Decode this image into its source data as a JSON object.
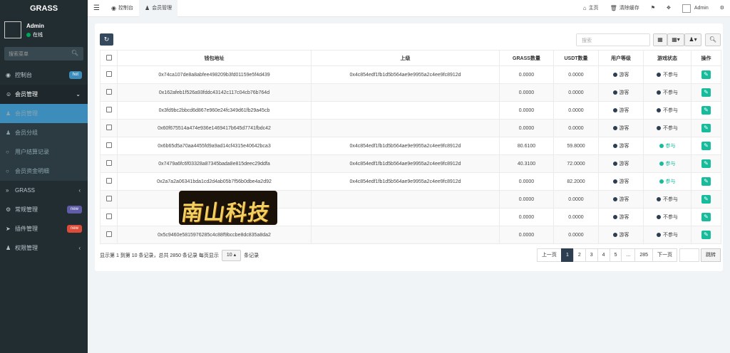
{
  "app": {
    "logo": "GRASS"
  },
  "user": {
    "name": "Admin",
    "status": "在线"
  },
  "sidebar": {
    "search_placeholder": "搜索菜单",
    "items": [
      {
        "label": "控制台",
        "badge": "hot",
        "badge_color": "#3c8dbc"
      },
      {
        "label": "会员管理"
      },
      {
        "label": "会员管理"
      },
      {
        "label": "会员分组"
      },
      {
        "label": "用户结算记录"
      },
      {
        "label": "会员资金明细"
      },
      {
        "label": "GRASS"
      },
      {
        "label": "常规管理",
        "badge": "new",
        "badge_color": "#605ca8"
      },
      {
        "label": "插件管理",
        "badge": "new",
        "badge_color": "#dd4b39"
      },
      {
        "label": "权限管理"
      }
    ]
  },
  "topbar": {
    "tabs": [
      {
        "label": "控制台"
      },
      {
        "label": "会员管理"
      }
    ],
    "home": "主页",
    "clear_cache": "清除缓存",
    "admin": "Admin"
  },
  "toolbar": {
    "search_placeholder": "搜索"
  },
  "table": {
    "headers": [
      "钱包地址",
      "上级",
      "GRASS数量",
      "USDT数量",
      "用户等级",
      "游戏状态",
      "操作"
    ],
    "rows": [
      {
        "wallet": "0x74ca107de8a8abfee498209b3fd01159e5f4d439",
        "parent": "0x4c854edf1fb1d5b564ae9e9955a2c4ee9fc8912d",
        "grass": "0.0000",
        "usdt": "0.0000",
        "level": "游客",
        "status": "不参与"
      },
      {
        "wallet": "0x162afeb1f526a93fddc43142c117c04cb76b764d",
        "parent": "",
        "grass": "0.0000",
        "usdt": "0.0000",
        "level": "游客",
        "status": "不参与"
      },
      {
        "wallet": "0x3fd9bc2bbcd6d867e960e24fc349d61fb29a45cb",
        "parent": "",
        "grass": "0.0000",
        "usdt": "0.0000",
        "level": "游客",
        "status": "不参与"
      },
      {
        "wallet": "0x60f675514a474e936e1469417b645d7741fbdc42",
        "parent": "",
        "grass": "0.0000",
        "usdt": "0.0000",
        "level": "游客",
        "status": "不参与"
      },
      {
        "wallet": "0x6b65d5a70aa4455fd9a9ad14cf4315e40642bca3",
        "parent": "0x4c854edf1fb1d5b564ae9e9955a2c4ee9fc8912d",
        "grass": "80.6100",
        "usdt": "59.8000",
        "level": "游客",
        "status": "参与"
      },
      {
        "wallet": "0x7479a6fc6f03328a87345bada8e815deec29ddfa",
        "parent": "0x4c854edf1fb1d5b564ae9e9955a2c4ee9fc8912d",
        "grass": "40.3100",
        "usdt": "72.0000",
        "level": "游客",
        "status": "参与"
      },
      {
        "wallet": "0x2a7a2a06341bda1cd2d4ab05b7f56b0dbe4a2d92",
        "parent": "0x4c854edf1fb1d5b564ae9e9955a2c4ee9fc8912d",
        "grass": "0.0000",
        "usdt": "82.2000",
        "level": "游客",
        "status": "参与"
      },
      {
        "wallet": "0xe0a9",
        "parent": "",
        "grass": "0.0000",
        "usdt": "0.0000",
        "level": "游客",
        "status": "不参与"
      },
      {
        "wallet": "0x2b6736",
        "parent": "",
        "grass": "0.0000",
        "usdt": "0.0000",
        "level": "游客",
        "status": "不参与"
      },
      {
        "wallet": "0x5c9460e5815976285c4c88f9bccbe8dc835a8da2",
        "parent": "",
        "grass": "0.0000",
        "usdt": "0.0000",
        "level": "游客",
        "status": "不参与"
      }
    ]
  },
  "footer": {
    "summary": "显示第 1 到第 10 条记录，总共 2850 条记录 每页显示",
    "page_size": "10",
    "records": "条记录"
  },
  "pagination": {
    "prev": "上一页",
    "pages": [
      "1",
      "2",
      "3",
      "4",
      "5",
      "...",
      "285"
    ],
    "next": "下一页",
    "go": "跳转"
  },
  "watermark": {
    "text": "南山科技"
  },
  "colors": {
    "participate": "#18bc9c",
    "not_participate": "#2c3e50",
    "level_dot": "#2c3e50"
  }
}
